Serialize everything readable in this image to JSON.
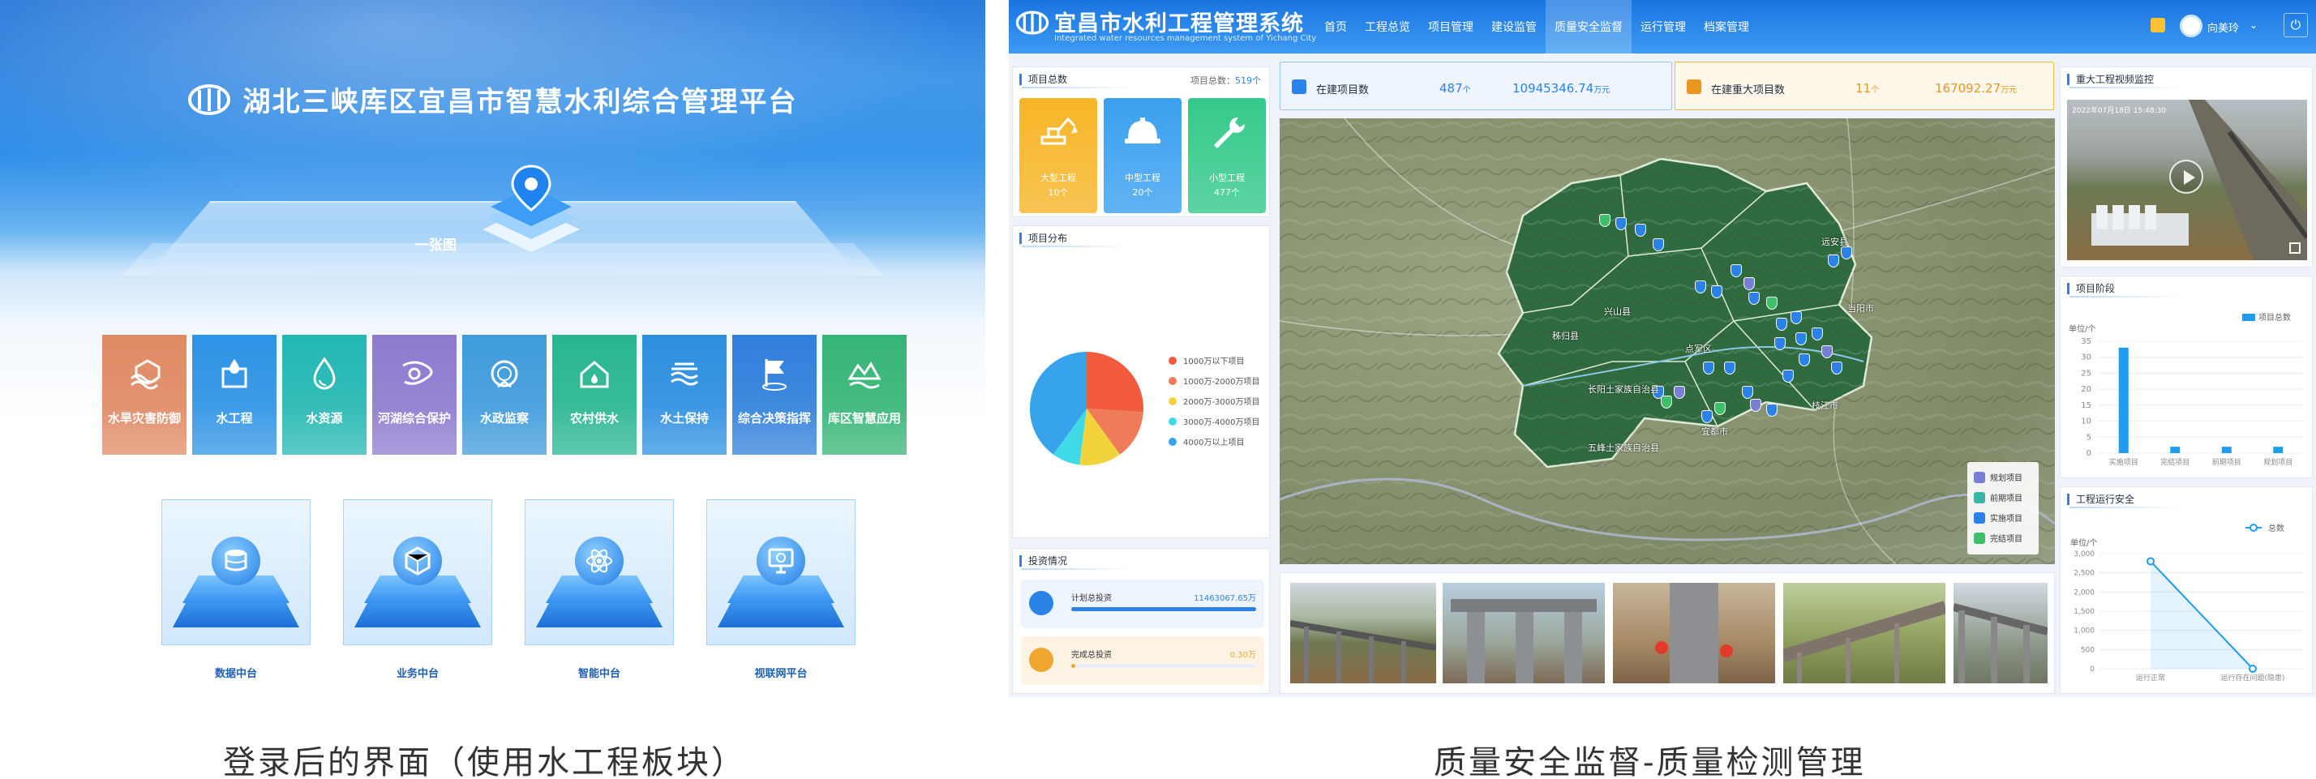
{
  "left": {
    "title": "湖北三峡库区宜昌市智慧水利综合管理平台",
    "hub_center_label": "一张图",
    "modules": [
      {
        "label": "水旱灾害防御",
        "color": "#e08a64",
        "icon": "flood-icon"
      },
      {
        "label": "水工程",
        "color": "#2d93e6",
        "icon": "water-project-icon"
      },
      {
        "label": "水资源",
        "color": "#23b7b3",
        "icon": "water-drop-icon"
      },
      {
        "label": "河湖综合保护",
        "color": "#8e7ad0",
        "icon": "river-icon"
      },
      {
        "label": "水政监察",
        "color": "#3f9bdc",
        "icon": "badge-icon"
      },
      {
        "label": "农村供水",
        "color": "#27b68f",
        "icon": "house-icon"
      },
      {
        "label": "水土保持",
        "color": "#2d8fe0",
        "icon": "soil-icon"
      },
      {
        "label": "综合决策指挥",
        "color": "#2f7fdc",
        "icon": "flag-icon"
      },
      {
        "label": "库区智慧应用",
        "color": "#35b575",
        "icon": "reservoir-icon"
      }
    ],
    "hubs": [
      {
        "label": "数据中台",
        "icon": "database-icon"
      },
      {
        "label": "业务中台",
        "icon": "cube-icon"
      },
      {
        "label": "智能中台",
        "icon": "atom-icon"
      },
      {
        "label": "视联网平台",
        "icon": "monitor-icon"
      }
    ]
  },
  "right": {
    "sys_title": "宜昌市水利工程管理系统",
    "sys_subtitle": "Integrated water resources management system of Yichang City",
    "nav": [
      "首页",
      "工程总览",
      "项目管理",
      "建设监管",
      "质量安全监督",
      "运行管理",
      "档案管理"
    ],
    "nav_active": 4,
    "user": "向美玲",
    "total_panel": {
      "title": "项目总数",
      "total_label": "项目总数：",
      "total_value": "519个",
      "cards": [
        {
          "label": "大型工程",
          "value": "10个",
          "color": "#f7b527",
          "icon": "excavator-icon"
        },
        {
          "label": "中型工程",
          "value": "20个",
          "color": "#3aa0f0",
          "icon": "helmet-icon"
        },
        {
          "label": "小型工程",
          "value": "477个",
          "color": "#34c98a",
          "icon": "wrench-icon"
        }
      ]
    },
    "dist_panel": {
      "title": "项目分布",
      "legend": [
        {
          "label": "1000万以下项目",
          "color": "#f25b3e"
        },
        {
          "label": "1000万-2000万项目",
          "color": "#ef7b58"
        },
        {
          "label": "2000万-3000万项目",
          "color": "#f3d33c"
        },
        {
          "label": "3000万-4000万项目",
          "color": "#3fd9e8"
        },
        {
          "label": "4000万以上项目",
          "color": "#36a3ea"
        }
      ]
    },
    "inv_panel": {
      "title": "投资情况",
      "rows": [
        {
          "label": "计划总投资",
          "value": "11463067.65万",
          "fill": 1.0,
          "color": "#2b83ea",
          "bg": "#eef5ff"
        },
        {
          "label": "完成总投资",
          "value": "0.30万",
          "fill": 0.01,
          "color": "#f1a531",
          "bg": "#fff4e3"
        }
      ]
    },
    "stats": [
      {
        "label": "在建项目数",
        "count": "487",
        "count_unit": "个",
        "money": "10945346.74",
        "money_unit": "万元",
        "color": "#2b83ea"
      },
      {
        "label": "在建重大项目数",
        "count": "11",
        "count_unit": "个",
        "money": "167092.27",
        "money_unit": "万元",
        "color": "#e9961f"
      }
    ],
    "map": {
      "place_labels": [
        "远安县",
        "兴山县",
        "秭归县",
        "点军区",
        "宜都市",
        "长阳土家族自治县",
        "当阳市",
        "枝江市",
        "五峰土家族自治县"
      ],
      "legend": [
        {
          "label": "规划项目",
          "color": "#7a7fd6"
        },
        {
          "label": "前期项目",
          "color": "#3bb5a8"
        },
        {
          "label": "实施项目",
          "color": "#2b83ea"
        },
        {
          "label": "完结项目",
          "color": "#3cc06a"
        }
      ]
    },
    "video_panel": {
      "title": "重大工程视频监控",
      "timestamp": "2022年07月18日 15:48:30"
    },
    "stage_panel": {
      "title": "项目阶段",
      "unit": "单位/个",
      "legend": "项目总数"
    },
    "safe_panel": {
      "title": "工程运行安全",
      "unit": "单位/个",
      "legend": "总数"
    }
  },
  "captions": [
    "登录后的界面（使用水工程板块）",
    "质量安全监督-质量检测管理"
  ],
  "chart_data": [
    {
      "type": "pie",
      "categories": [
        "1000万以下项目",
        "1000万-2000万项目",
        "2000万-3000万项目",
        "3000万-4000万项目",
        "4000万以上项目"
      ],
      "values": [
        26,
        14,
        12,
        8,
        40
      ],
      "colors": [
        "#f25b3e",
        "#ef7b58",
        "#f3d33c",
        "#3fd9e8",
        "#36a3ea"
      ]
    },
    {
      "type": "bar",
      "categories": [
        "实施项目",
        "完结项目",
        "前期项目",
        "规划项目"
      ],
      "values": [
        33,
        2,
        2,
        2
      ],
      "legend": "项目总数",
      "ylabel": "单位/个",
      "ylim": [
        0,
        35
      ],
      "yticks": [
        0,
        5,
        10,
        15,
        20,
        25,
        30,
        35
      ]
    },
    {
      "type": "line",
      "categories": [
        "运行正常",
        "运行存在问题(隐患)"
      ],
      "values": [
        2800,
        0
      ],
      "legend": "总数",
      "ylabel": "单位/个",
      "ylim": [
        0,
        3000
      ],
      "yticks": [
        0,
        500,
        1000,
        1500,
        2000,
        2500,
        3000
      ],
      "ytick_labels": [
        "0",
        "500",
        "1,000",
        "1,500",
        "2,000",
        "2,500",
        "3,000"
      ]
    }
  ]
}
